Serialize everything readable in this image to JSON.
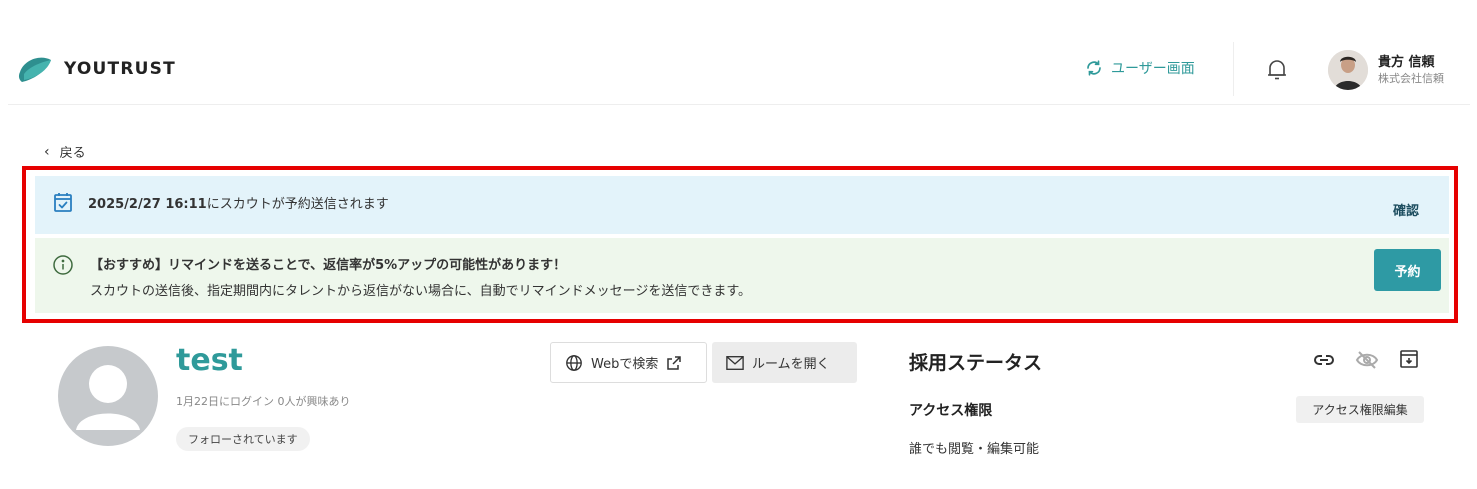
{
  "header": {
    "brand": "YOUTRUST",
    "switch_label": "ユーザー画面",
    "user_name": "貴方 信頼",
    "user_company": "株式会社信頼"
  },
  "back_label": "戻る",
  "scheduled_banner": {
    "datetime": "2025/2/27 16:11",
    "message": "にスカウトが予約送信されます",
    "confirm_label": "確認"
  },
  "remind_banner": {
    "title": "【おすすめ】リマインドを送ることで、返信率が5%アップの可能性があります！",
    "description": "スカウトの送信後、指定期間内にタレントから返信がない場合に、自動でリマインドメッセージを送信できます。",
    "reserve_label": "予約"
  },
  "profile": {
    "name": "test",
    "meta": "1月22日にログイン  0人が興味あり",
    "follow_status": "フォローされています",
    "web_search_label": "Webで検索",
    "open_room_label": "ルームを開く"
  },
  "panel": {
    "status_title": "採用ステータス",
    "access_title": "アクセス権限",
    "access_edit_label": "アクセス権限編集",
    "access_value": "誰でも閲覧・編集可能"
  },
  "colors": {
    "accent": "#2f9a9a",
    "highlight": "#e60000",
    "info_bg": "#e3f3fa",
    "tip_bg": "#eef7ec"
  }
}
